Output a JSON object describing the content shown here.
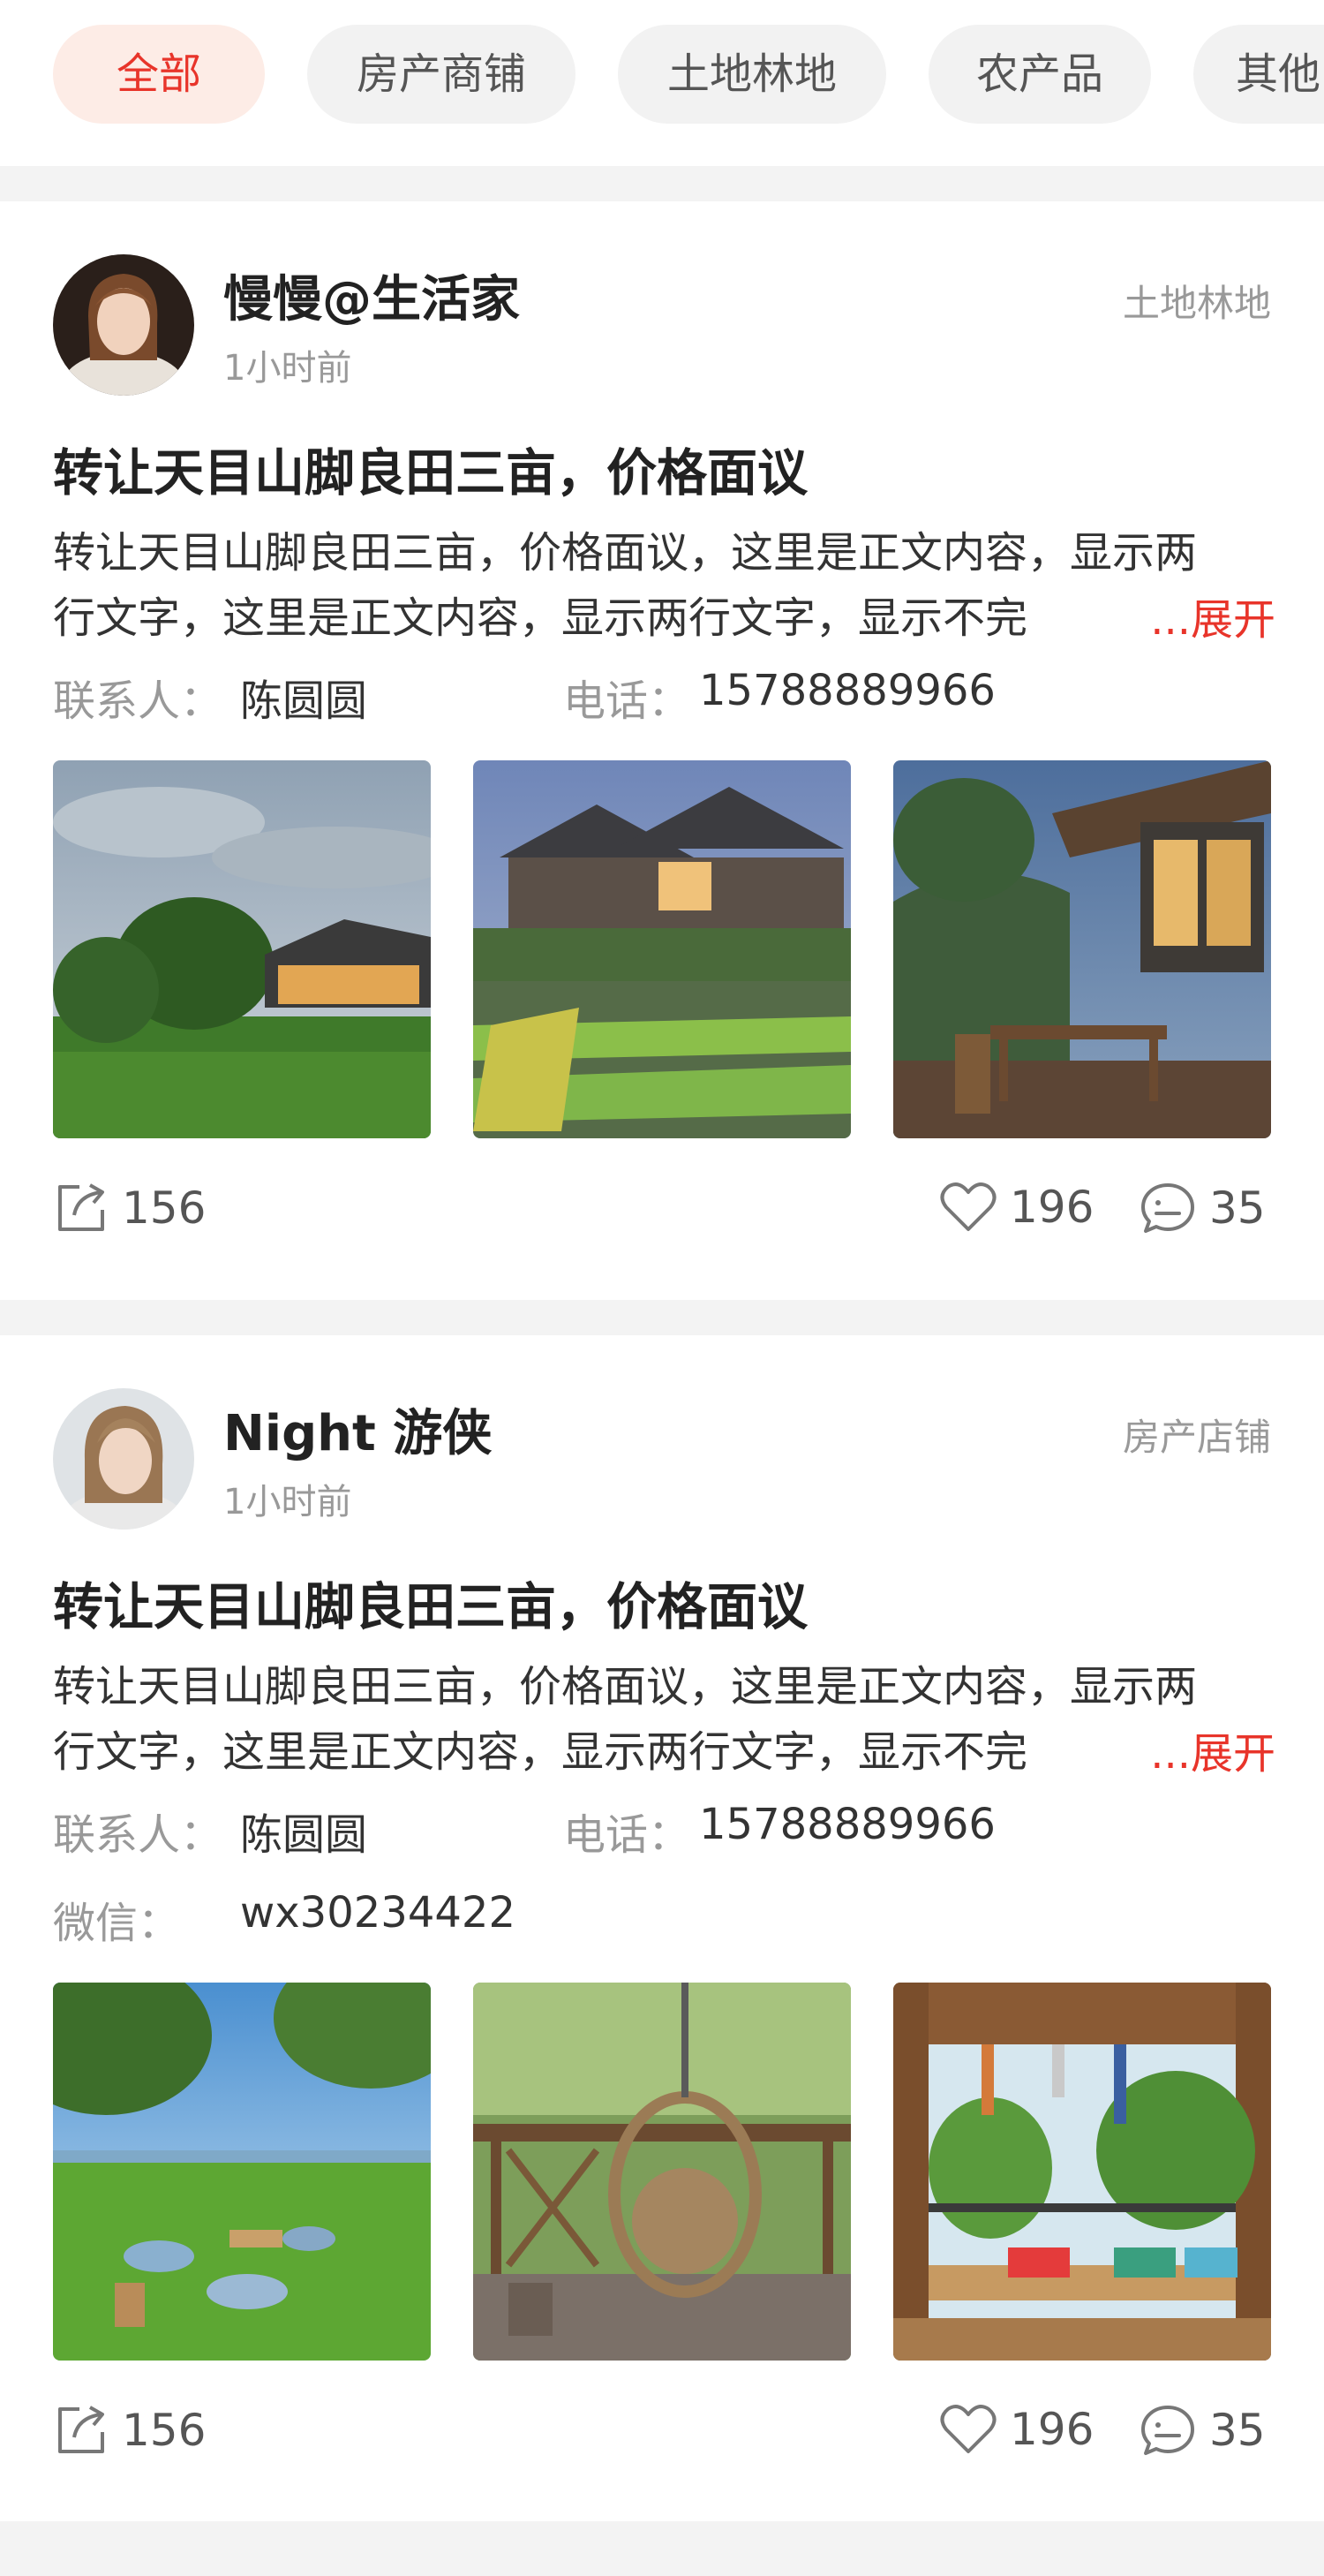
{
  "tabs": [
    "全部",
    "房产商铺",
    "土地林地",
    "农产品",
    "其他"
  ],
  "active_tab": "全部",
  "labels": {
    "contact": "联系人：",
    "phone": "电话：",
    "wechat": "微信：",
    "expand": "...展开"
  },
  "icons": [
    "share-icon",
    "heart-icon",
    "comment-icon"
  ],
  "colors": {
    "accent": "#e8342a",
    "active_tab_bg": "#fdece6"
  },
  "posts": [
    {
      "author": "慢慢@生活家",
      "time": "1小时前",
      "category": "土地林地",
      "title": "转让天目山脚良田三亩，价格面议",
      "body_line1": "转让天目山脚良田三亩，价格面议，这里是正文内容，显示两",
      "body_line2": "行文字，这里是正文内容，显示两行文字，显示不完",
      "contact": "陈圆圆",
      "phone": "15788889966",
      "shares": "156",
      "likes": "196",
      "comments": "35"
    },
    {
      "author": "Night 游侠",
      "time": "1小时前",
      "category": "房产店铺",
      "title": "转让天目山脚良田三亩，价格面议",
      "body_line1": "转让天目山脚良田三亩，价格面议，这里是正文内容，显示两",
      "body_line2": "行文字，这里是正文内容，显示两行文字，显示不完",
      "contact": "陈圆圆",
      "phone": "15788889966",
      "wechat": "wx30234422",
      "shares": "156",
      "likes": "196",
      "comments": "35"
    }
  ]
}
